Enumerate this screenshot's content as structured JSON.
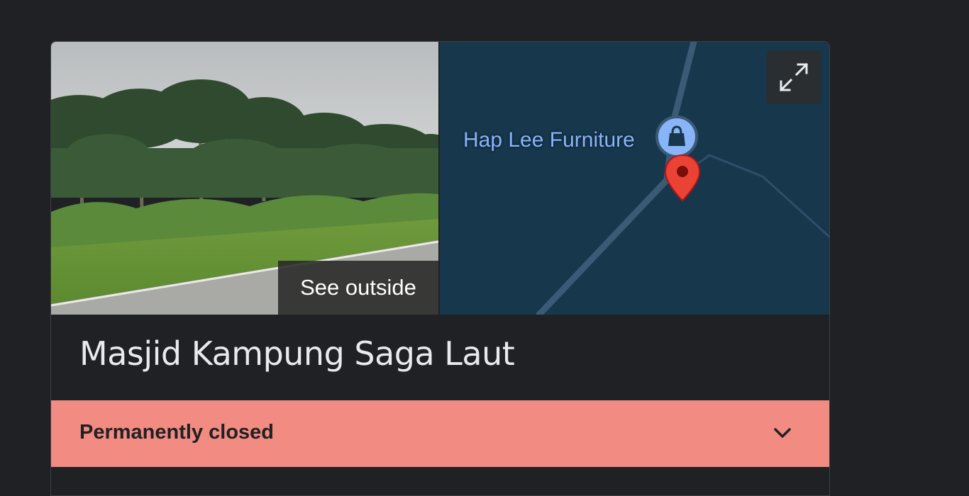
{
  "photo": {
    "button_label": "See outside",
    "scene_icon": "street-view-photo"
  },
  "map": {
    "place_label": "Hap Lee Furniture",
    "place_icon": "shopping-bag-icon",
    "pin_icon": "red-location-pin-icon",
    "expand_icon": "expand-fullscreen-icon",
    "background_color": "#17374d",
    "road_color": "#3a5a75"
  },
  "place": {
    "name": "Masjid Kampung Saga Laut"
  },
  "status": {
    "label": "Permanently closed",
    "color": "#f28b82",
    "toggle_icon": "chevron-down-icon"
  },
  "theme": {
    "background": "#202124",
    "text_primary": "#e8eaed",
    "link_blue": "#8ab4f8"
  }
}
